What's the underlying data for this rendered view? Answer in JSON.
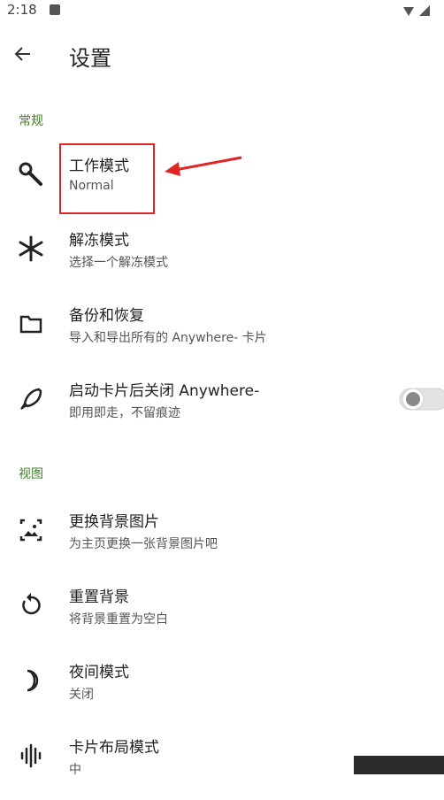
{
  "status": {
    "time": "2:18"
  },
  "header": {
    "title": "设置"
  },
  "sections": [
    {
      "label": "常规"
    },
    {
      "label": "视图"
    }
  ],
  "items": [
    {
      "title": "工作模式",
      "subtitle": "Normal",
      "icon": "wrench-icon"
    },
    {
      "title": "解冻模式",
      "subtitle": "选择一个解冻模式",
      "icon": "snowflake-icon"
    },
    {
      "title": "备份和恢复",
      "subtitle": "导入和导出所有的 Anywhere- 卡片",
      "icon": "folder-icon"
    },
    {
      "title": "启动卡片后关闭 Anywhere-",
      "subtitle": "即用即走，不留痕迹",
      "icon": "rocket-icon",
      "toggle": false
    },
    {
      "title": "更换背景图片",
      "subtitle": "为主页更换一张背景图片吧",
      "icon": "image-icon"
    },
    {
      "title": "重置背景",
      "subtitle": "将背景重置为空白",
      "icon": "reset-icon"
    },
    {
      "title": "夜间模式",
      "subtitle": "关闭",
      "icon": "moon-icon"
    },
    {
      "title": "卡片布局模式",
      "subtitle": "中",
      "icon": "layout-icon"
    }
  ],
  "colors": {
    "section": "#3f7d2a",
    "annotation": "#e02525"
  }
}
